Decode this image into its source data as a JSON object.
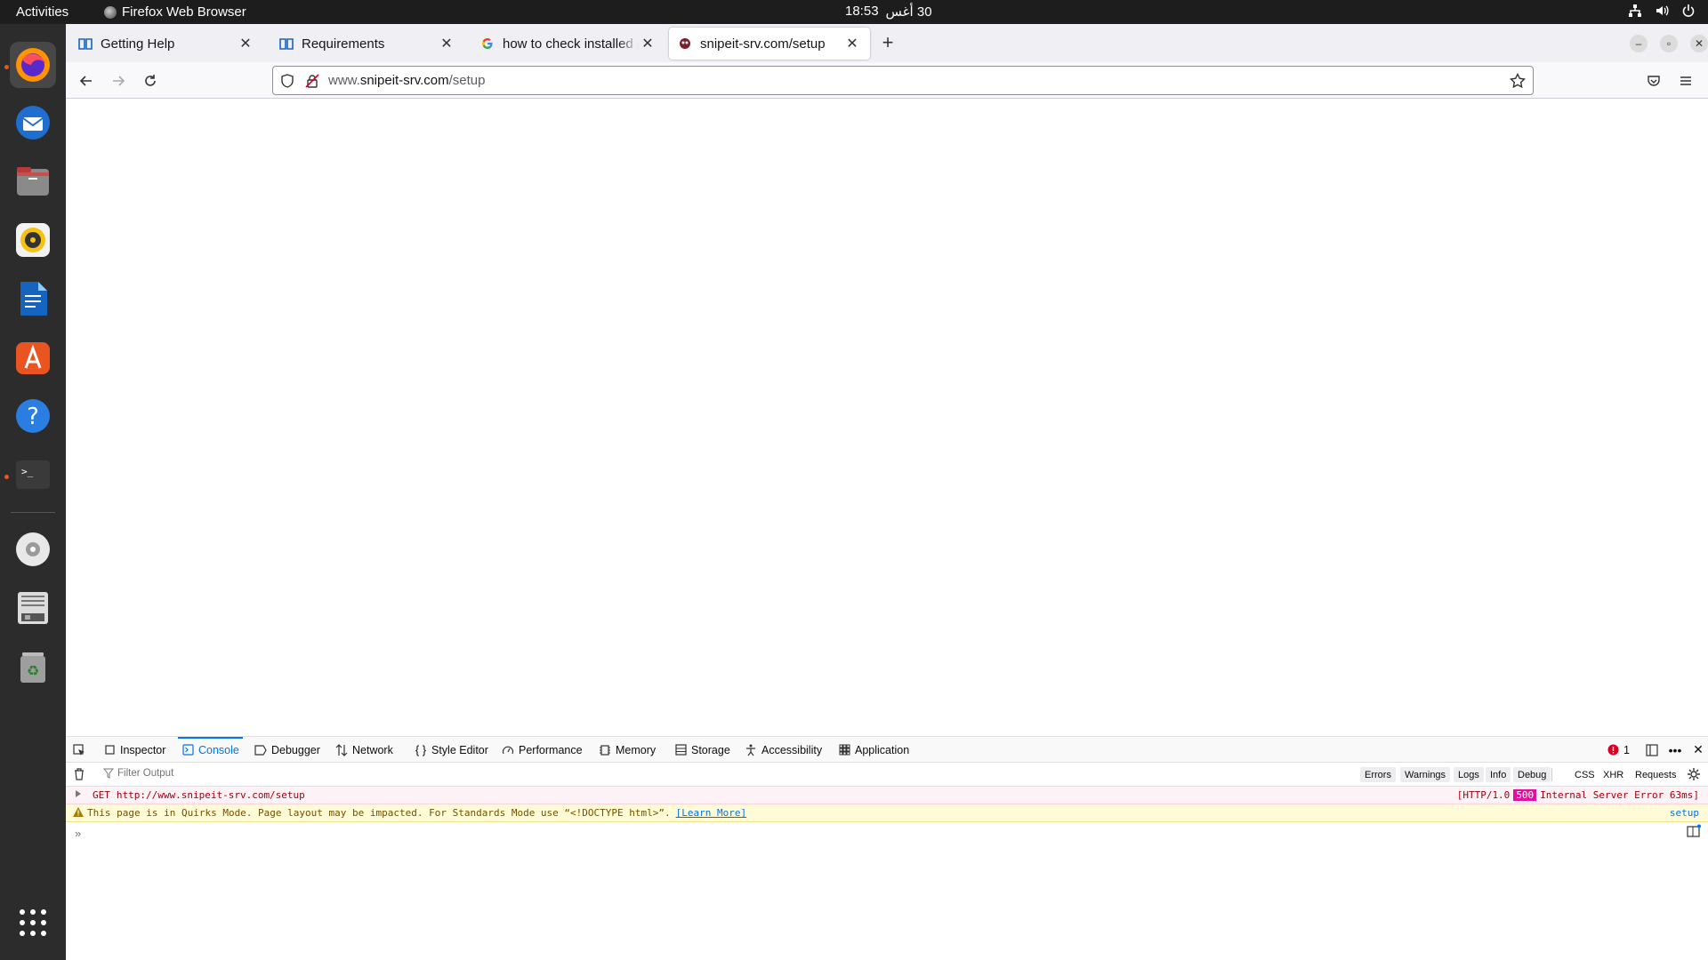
{
  "topbar": {
    "activities": "Activities",
    "app_name": "Firefox Web Browser",
    "time": "18:53",
    "date": "30 أغس"
  },
  "dock": {
    "items": [
      "firefox-icon",
      "thunderbird-icon",
      "files-icon",
      "rhythmbox-icon",
      "writer-icon",
      "app-center-icon",
      "help-icon",
      "terminal-icon",
      "dvd-icon",
      "disk-image-icon",
      "trash-icon",
      "show-apps-icon"
    ]
  },
  "tabs": [
    {
      "label": "Getting Help",
      "icon": "doc-icon",
      "active": false
    },
    {
      "label": "Requirements",
      "icon": "doc-icon",
      "active": false
    },
    {
      "label": "how to check installed ph",
      "icon": "google-icon",
      "active": false
    },
    {
      "label": "snipeit-srv.com/setup",
      "icon": "site-icon",
      "active": true
    }
  ],
  "urlbar": {
    "url_prefix": "www.",
    "url_domain": "snipeit-srv.com",
    "url_path": "/setup"
  },
  "devtools": {
    "tabs": [
      "Inspector",
      "Console",
      "Debugger",
      "Network",
      "Style Editor",
      "Performance",
      "Memory",
      "Storage",
      "Accessibility",
      "Application"
    ],
    "active_tab": "Console",
    "error_count": "1",
    "filter_placeholder": "Filter Output",
    "filter_buttons": [
      "Errors",
      "Warnings",
      "Logs",
      "Info",
      "Debug"
    ],
    "type_buttons": [
      "CSS",
      "XHR",
      "Requests"
    ],
    "messages": {
      "error": {
        "method": "GET",
        "url": "http://www.snipeit-srv.com/setup",
        "status_prefix": "[HTTP/1.0",
        "status_code": "500",
        "status_suffix": "Internal Server Error 63ms]"
      },
      "warning": {
        "text": "This page is in Quirks Mode. Page layout may be impacted. For Standards Mode use “<!DOCTYPE html>”.",
        "link": "[Learn More]",
        "source": "setup"
      }
    }
  },
  "colors": {
    "accent": "#0074e8",
    "dock_indicator": "#e95420",
    "error_text": "#a4000f",
    "status_badge": "#e0119d"
  }
}
